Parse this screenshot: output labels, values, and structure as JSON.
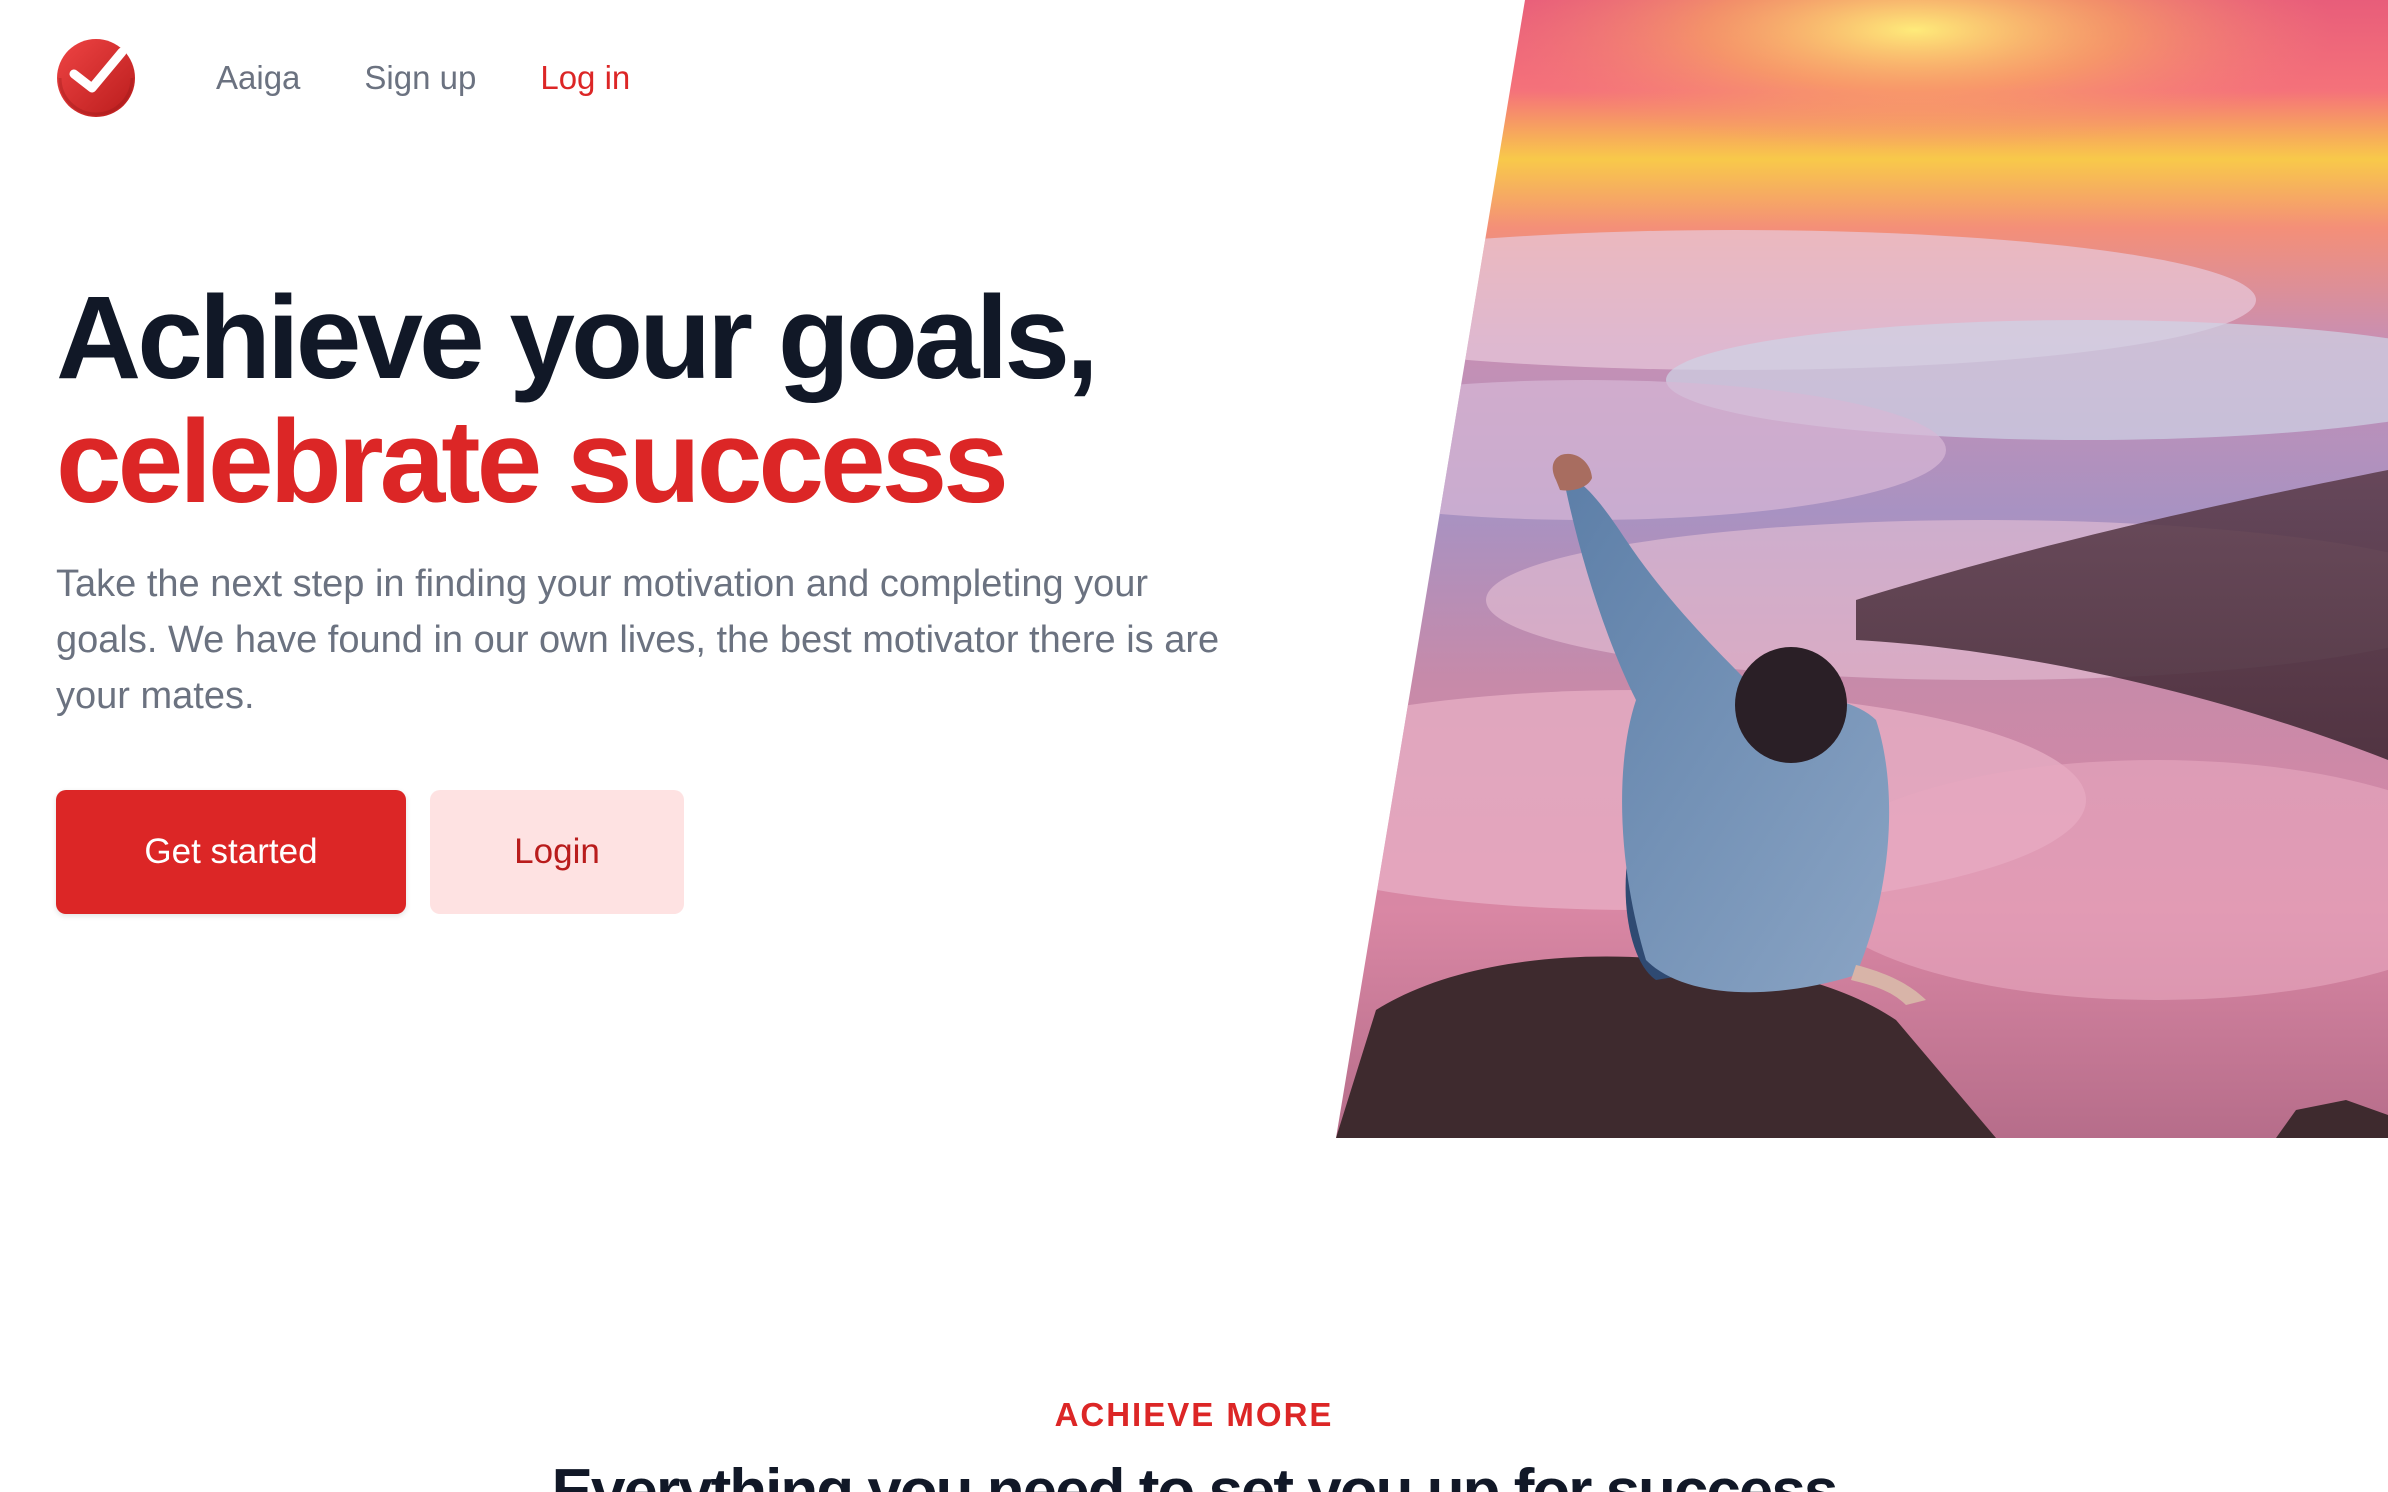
{
  "nav": {
    "brand": "Aaiga",
    "signup": "Sign up",
    "login": "Log in"
  },
  "hero": {
    "headline_line1": "Achieve your goals,",
    "headline_line2": "celebrate success",
    "lead": "Take the next step in finding your motivation and completing your goals. We have found in our own lives, the best motivator there is are your mates.",
    "primary_cta": "Get started",
    "secondary_cta": "Login",
    "image_description_icon": "person-on-mountain-above-clouds-image"
  },
  "features": {
    "eyebrow": "ACHIEVE MORE",
    "title": "Everything you need to set you up for success"
  },
  "colors": {
    "accent": "#dc2626",
    "accent_soft": "#fee2e2",
    "heading": "#111827",
    "muted": "#6b7280"
  }
}
